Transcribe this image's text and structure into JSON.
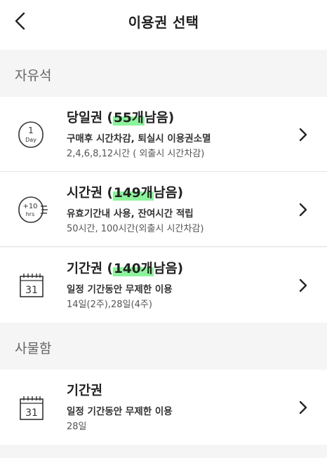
{
  "header": {
    "title": "이용권 선택"
  },
  "sections": [
    {
      "label": "자유석",
      "items": [
        {
          "icon": "day-icon",
          "icon_text": [
            "1",
            "Day"
          ],
          "name": "당일권",
          "count": "55개",
          "remain": "남음",
          "desc": "구매후 시간차감, 퇴실시 이용권소멸",
          "detail": "2,4,6,8,12시간 ( 외출시 시간차감)"
        },
        {
          "icon": "plus-10-hours-icon",
          "icon_text": [
            "+10",
            "hrs"
          ],
          "name": "시간권",
          "count": "149개",
          "remain": "남음",
          "desc": "유효기간내 사용, 잔여시간 적립",
          "detail": "50시간, 100시간(외출시 시간차감)"
        },
        {
          "icon": "calendar-icon",
          "icon_text": [
            "31"
          ],
          "name": "기간권",
          "count": "140개",
          "remain": "남음",
          "desc": "일정 기간동안 무제한 이용",
          "detail": "14일(2주),28일(4주)"
        }
      ]
    },
    {
      "label": "사물함",
      "items": [
        {
          "icon": "calendar-icon",
          "icon_text": [
            "31"
          ],
          "name": "기간권",
          "desc": "일정 기간동안 무제한 이용",
          "detail": "28일"
        }
      ]
    }
  ],
  "colors": {
    "highlight": "#8cf29b",
    "section_bg": "#f5f5f5",
    "card_bg": "#ffffff"
  }
}
